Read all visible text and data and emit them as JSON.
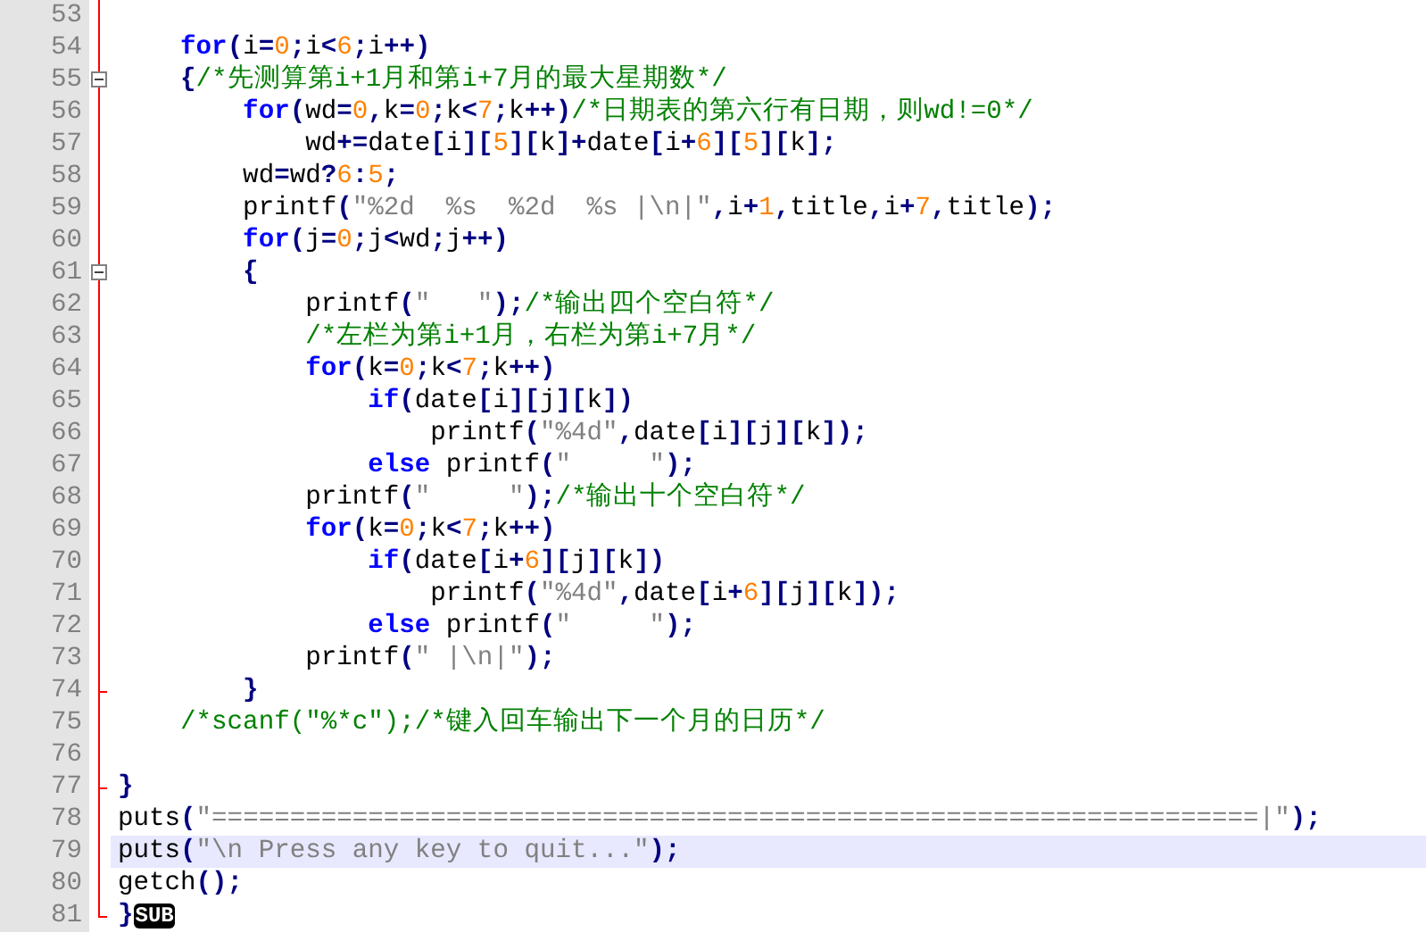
{
  "editor": {
    "lines": [
      {
        "number": "53",
        "kind": "plain",
        "current": false
      },
      {
        "number": "54",
        "kind": "plain",
        "current": false,
        "tokens": [
          {
            "kind": "kw",
            "text": "    for"
          },
          {
            "kind": "op",
            "text": "("
          },
          {
            "kind": "id",
            "text": "i"
          },
          {
            "kind": "op",
            "text": "="
          },
          {
            "kind": "num",
            "text": "0"
          },
          {
            "kind": "op",
            "text": ";"
          },
          {
            "kind": "id",
            "text": "i"
          },
          {
            "kind": "op",
            "text": "<"
          },
          {
            "kind": "num",
            "text": "6"
          },
          {
            "kind": "op",
            "text": ";"
          },
          {
            "kind": "id",
            "text": "i"
          },
          {
            "kind": "op",
            "text": "++)"
          }
        ]
      },
      {
        "number": "55",
        "kind": "fold_start",
        "current": false,
        "tokens": [
          {
            "kind": "op",
            "text": "    {"
          },
          {
            "kind": "cmt",
            "text": "/*先测算第i+1月和第i+7月的最大星期数*/"
          }
        ]
      },
      {
        "number": "56",
        "kind": "plain",
        "current": false,
        "tokens": [
          {
            "kind": "kw",
            "text": "        for"
          },
          {
            "kind": "op",
            "text": "("
          },
          {
            "kind": "id",
            "text": "wd"
          },
          {
            "kind": "op",
            "text": "="
          },
          {
            "kind": "num",
            "text": "0"
          },
          {
            "kind": "op",
            "text": ","
          },
          {
            "kind": "id",
            "text": "k"
          },
          {
            "kind": "op",
            "text": "="
          },
          {
            "kind": "num",
            "text": "0"
          },
          {
            "kind": "op",
            "text": ";"
          },
          {
            "kind": "id",
            "text": "k"
          },
          {
            "kind": "op",
            "text": "<"
          },
          {
            "kind": "num",
            "text": "7"
          },
          {
            "kind": "op",
            "text": ";"
          },
          {
            "kind": "id",
            "text": "k"
          },
          {
            "kind": "op",
            "text": "++)"
          },
          {
            "kind": "cmt",
            "text": "/*日期表的第六行有日期，则wd!=0*/"
          }
        ]
      },
      {
        "number": "57",
        "kind": "plain",
        "current": false,
        "tokens": [
          {
            "kind": "id",
            "text": "            wd"
          },
          {
            "kind": "op",
            "text": "+="
          },
          {
            "kind": "id",
            "text": "date"
          },
          {
            "kind": "op",
            "text": "["
          },
          {
            "kind": "id",
            "text": "i"
          },
          {
            "kind": "op",
            "text": "]["
          },
          {
            "kind": "num",
            "text": "5"
          },
          {
            "kind": "op",
            "text": "]["
          },
          {
            "kind": "id",
            "text": "k"
          },
          {
            "kind": "op",
            "text": "]+"
          },
          {
            "kind": "id",
            "text": "date"
          },
          {
            "kind": "op",
            "text": "["
          },
          {
            "kind": "id",
            "text": "i"
          },
          {
            "kind": "op",
            "text": "+"
          },
          {
            "kind": "num",
            "text": "6"
          },
          {
            "kind": "op",
            "text": "]["
          },
          {
            "kind": "num",
            "text": "5"
          },
          {
            "kind": "op",
            "text": "]["
          },
          {
            "kind": "id",
            "text": "k"
          },
          {
            "kind": "op",
            "text": "];"
          }
        ]
      },
      {
        "number": "58",
        "kind": "plain",
        "current": false,
        "tokens": [
          {
            "kind": "id",
            "text": "        wd"
          },
          {
            "kind": "op",
            "text": "="
          },
          {
            "kind": "id",
            "text": "wd"
          },
          {
            "kind": "op",
            "text": "?"
          },
          {
            "kind": "num",
            "text": "6"
          },
          {
            "kind": "op",
            "text": ":"
          },
          {
            "kind": "num",
            "text": "5"
          },
          {
            "kind": "op",
            "text": ";"
          }
        ]
      },
      {
        "number": "59",
        "kind": "plain",
        "current": false,
        "tokens": [
          {
            "kind": "id",
            "text": "        printf"
          },
          {
            "kind": "op",
            "text": "("
          },
          {
            "kind": "str",
            "text": "\"%2d  %s  %2d  %s |\\n|\""
          },
          {
            "kind": "op",
            "text": ","
          },
          {
            "kind": "id",
            "text": "i"
          },
          {
            "kind": "op",
            "text": "+"
          },
          {
            "kind": "num",
            "text": "1"
          },
          {
            "kind": "op",
            "text": ","
          },
          {
            "kind": "id",
            "text": "title"
          },
          {
            "kind": "op",
            "text": ","
          },
          {
            "kind": "id",
            "text": "i"
          },
          {
            "kind": "op",
            "text": "+"
          },
          {
            "kind": "num",
            "text": "7"
          },
          {
            "kind": "op",
            "text": ","
          },
          {
            "kind": "id",
            "text": "title"
          },
          {
            "kind": "op",
            "text": ");"
          }
        ]
      },
      {
        "number": "60",
        "kind": "plain",
        "current": false,
        "tokens": [
          {
            "kind": "kw",
            "text": "        for"
          },
          {
            "kind": "op",
            "text": "("
          },
          {
            "kind": "id",
            "text": "j"
          },
          {
            "kind": "op",
            "text": "="
          },
          {
            "kind": "num",
            "text": "0"
          },
          {
            "kind": "op",
            "text": ";"
          },
          {
            "kind": "id",
            "text": "j"
          },
          {
            "kind": "op",
            "text": "<"
          },
          {
            "kind": "id",
            "text": "wd"
          },
          {
            "kind": "op",
            "text": ";"
          },
          {
            "kind": "id",
            "text": "j"
          },
          {
            "kind": "op",
            "text": "++)"
          }
        ]
      },
      {
        "number": "61",
        "kind": "fold_start",
        "current": false,
        "tokens": [
          {
            "kind": "op",
            "text": "        {"
          }
        ]
      },
      {
        "number": "62",
        "kind": "plain",
        "current": false,
        "tokens": [
          {
            "kind": "id",
            "text": "            printf"
          },
          {
            "kind": "op",
            "text": "("
          },
          {
            "kind": "str",
            "text": "\"   \""
          },
          {
            "kind": "op",
            "text": ");"
          },
          {
            "kind": "cmt",
            "text": "/*输出四个空白符*/"
          }
        ]
      },
      {
        "number": "63",
        "kind": "plain",
        "current": false,
        "tokens": [
          {
            "kind": "cmt",
            "text": "            /*左栏为第i+1月，右栏为第i+7月*/"
          }
        ]
      },
      {
        "number": "64",
        "kind": "plain",
        "current": false,
        "tokens": [
          {
            "kind": "kw",
            "text": "            for"
          },
          {
            "kind": "op",
            "text": "("
          },
          {
            "kind": "id",
            "text": "k"
          },
          {
            "kind": "op",
            "text": "="
          },
          {
            "kind": "num",
            "text": "0"
          },
          {
            "kind": "op",
            "text": ";"
          },
          {
            "kind": "id",
            "text": "k"
          },
          {
            "kind": "op",
            "text": "<"
          },
          {
            "kind": "num",
            "text": "7"
          },
          {
            "kind": "op",
            "text": ";"
          },
          {
            "kind": "id",
            "text": "k"
          },
          {
            "kind": "op",
            "text": "++)"
          }
        ]
      },
      {
        "number": "65",
        "kind": "plain",
        "current": false,
        "tokens": [
          {
            "kind": "kw",
            "text": "                if"
          },
          {
            "kind": "op",
            "text": "("
          },
          {
            "kind": "id",
            "text": "date"
          },
          {
            "kind": "op",
            "text": "["
          },
          {
            "kind": "id",
            "text": "i"
          },
          {
            "kind": "op",
            "text": "]["
          },
          {
            "kind": "id",
            "text": "j"
          },
          {
            "kind": "op",
            "text": "]["
          },
          {
            "kind": "id",
            "text": "k"
          },
          {
            "kind": "op",
            "text": "])"
          }
        ]
      },
      {
        "number": "66",
        "kind": "plain",
        "current": false,
        "tokens": [
          {
            "kind": "id",
            "text": "                    printf"
          },
          {
            "kind": "op",
            "text": "("
          },
          {
            "kind": "str",
            "text": "\"%4d\""
          },
          {
            "kind": "op",
            "text": ","
          },
          {
            "kind": "id",
            "text": "date"
          },
          {
            "kind": "op",
            "text": "["
          },
          {
            "kind": "id",
            "text": "i"
          },
          {
            "kind": "op",
            "text": "]["
          },
          {
            "kind": "id",
            "text": "j"
          },
          {
            "kind": "op",
            "text": "]["
          },
          {
            "kind": "id",
            "text": "k"
          },
          {
            "kind": "op",
            "text": "]);"
          }
        ]
      },
      {
        "number": "67",
        "kind": "plain",
        "current": false,
        "tokens": [
          {
            "kind": "kw",
            "text": "                else"
          },
          {
            "kind": "id",
            "text": " printf"
          },
          {
            "kind": "op",
            "text": "("
          },
          {
            "kind": "str",
            "text": "\"     \""
          },
          {
            "kind": "op",
            "text": ");"
          }
        ]
      },
      {
        "number": "68",
        "kind": "plain",
        "current": false,
        "tokens": [
          {
            "kind": "id",
            "text": "            printf"
          },
          {
            "kind": "op",
            "text": "("
          },
          {
            "kind": "str",
            "text": "\"     \""
          },
          {
            "kind": "op",
            "text": ");"
          },
          {
            "kind": "cmt",
            "text": "/*输出十个空白符*/"
          }
        ]
      },
      {
        "number": "69",
        "kind": "plain",
        "current": false,
        "tokens": [
          {
            "kind": "kw",
            "text": "            for"
          },
          {
            "kind": "op",
            "text": "("
          },
          {
            "kind": "id",
            "text": "k"
          },
          {
            "kind": "op",
            "text": "="
          },
          {
            "kind": "num",
            "text": "0"
          },
          {
            "kind": "op",
            "text": ";"
          },
          {
            "kind": "id",
            "text": "k"
          },
          {
            "kind": "op",
            "text": "<"
          },
          {
            "kind": "num",
            "text": "7"
          },
          {
            "kind": "op",
            "text": ";"
          },
          {
            "kind": "id",
            "text": "k"
          },
          {
            "kind": "op",
            "text": "++)"
          }
        ]
      },
      {
        "number": "70",
        "kind": "plain",
        "current": false,
        "tokens": [
          {
            "kind": "kw",
            "text": "                if"
          },
          {
            "kind": "op",
            "text": "("
          },
          {
            "kind": "id",
            "text": "date"
          },
          {
            "kind": "op",
            "text": "["
          },
          {
            "kind": "id",
            "text": "i"
          },
          {
            "kind": "op",
            "text": "+"
          },
          {
            "kind": "num",
            "text": "6"
          },
          {
            "kind": "op",
            "text": "]["
          },
          {
            "kind": "id",
            "text": "j"
          },
          {
            "kind": "op",
            "text": "]["
          },
          {
            "kind": "id",
            "text": "k"
          },
          {
            "kind": "op",
            "text": "])"
          }
        ]
      },
      {
        "number": "71",
        "kind": "plain",
        "current": false,
        "tokens": [
          {
            "kind": "id",
            "text": "                    printf"
          },
          {
            "kind": "op",
            "text": "("
          },
          {
            "kind": "str",
            "text": "\"%4d\""
          },
          {
            "kind": "op",
            "text": ","
          },
          {
            "kind": "id",
            "text": "date"
          },
          {
            "kind": "op",
            "text": "["
          },
          {
            "kind": "id",
            "text": "i"
          },
          {
            "kind": "op",
            "text": "+"
          },
          {
            "kind": "num",
            "text": "6"
          },
          {
            "kind": "op",
            "text": "]["
          },
          {
            "kind": "id",
            "text": "j"
          },
          {
            "kind": "op",
            "text": "]["
          },
          {
            "kind": "id",
            "text": "k"
          },
          {
            "kind": "op",
            "text": "]);"
          }
        ]
      },
      {
        "number": "72",
        "kind": "plain",
        "current": false,
        "tokens": [
          {
            "kind": "kw",
            "text": "                else"
          },
          {
            "kind": "id",
            "text": " printf"
          },
          {
            "kind": "op",
            "text": "("
          },
          {
            "kind": "str",
            "text": "\"     \""
          },
          {
            "kind": "op",
            "text": ");"
          }
        ]
      },
      {
        "number": "73",
        "kind": "plain",
        "current": false,
        "tokens": [
          {
            "kind": "id",
            "text": "            printf"
          },
          {
            "kind": "op",
            "text": "("
          },
          {
            "kind": "str",
            "text": "\" |\\n|\""
          },
          {
            "kind": "op",
            "text": ");"
          }
        ]
      },
      {
        "number": "74",
        "kind": "fold_end",
        "current": false,
        "tokens": [
          {
            "kind": "op",
            "text": "        }"
          }
        ]
      },
      {
        "number": "75",
        "kind": "plain",
        "current": false,
        "tokens": [
          {
            "kind": "cmt",
            "text": "    /*scanf(\"%*c\");/*键入回车输出下一个月的日历*/"
          }
        ]
      },
      {
        "number": "76",
        "kind": "plain",
        "current": false
      },
      {
        "number": "77",
        "kind": "fold_end",
        "current": false,
        "tokens": [
          {
            "kind": "op",
            "text": "}"
          }
        ]
      },
      {
        "number": "78",
        "kind": "plain",
        "current": false,
        "tokens": [
          {
            "kind": "id",
            "text": "puts"
          },
          {
            "kind": "op",
            "text": "("
          },
          {
            "kind": "str",
            "text": "\"===================================================================|\""
          },
          {
            "kind": "op",
            "text": ");"
          }
        ]
      },
      {
        "number": "79",
        "kind": "plain",
        "current": true,
        "tokens": [
          {
            "kind": "id",
            "text": "puts"
          },
          {
            "kind": "op",
            "text": "("
          },
          {
            "kind": "str",
            "text": "\"\\n Press any key to quit...\""
          },
          {
            "kind": "op",
            "text": ");"
          }
        ]
      },
      {
        "number": "80",
        "kind": "plain",
        "current": false,
        "tokens": [
          {
            "kind": "id",
            "text": "getch"
          },
          {
            "kind": "op",
            "text": "();"
          }
        ]
      },
      {
        "number": "81",
        "kind": "fold_last",
        "current": false,
        "tokens": [
          {
            "kind": "op",
            "text": "}"
          },
          {
            "kind": "ctl",
            "text": "SUB"
          }
        ]
      }
    ]
  }
}
